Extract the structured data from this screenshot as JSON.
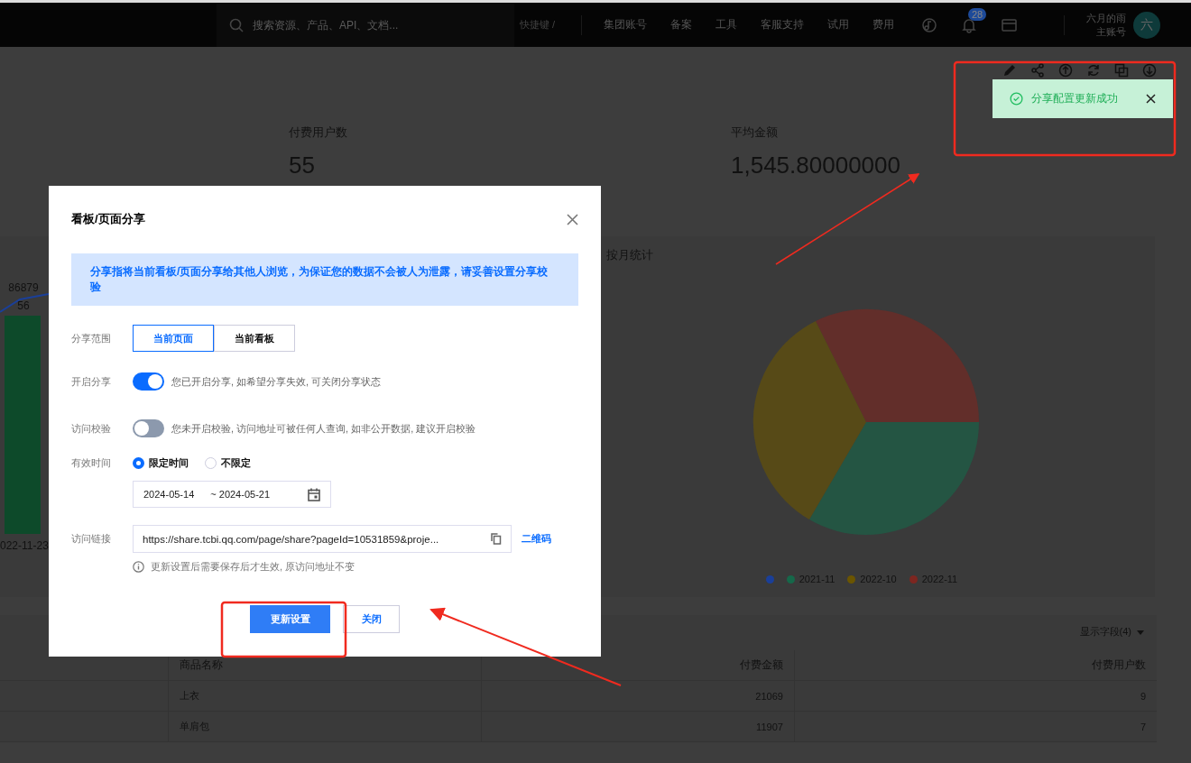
{
  "top_bar": {
    "search": {
      "placeholder": "搜索资源、产品、API、文档..."
    },
    "shortcut": "快捷键 /",
    "nav": [
      "集团账号",
      "备案",
      "工具",
      "客服支持",
      "试用",
      "费用"
    ],
    "notifications": "28",
    "user": {
      "name": "六月的雨",
      "role": "主账号",
      "avatar": "六"
    }
  },
  "toast": {
    "message": "分享配置更新成功"
  },
  "kpis": [
    {
      "label": "付费用户数",
      "value": "55"
    },
    {
      "label": "平均金额",
      "value": "1,545.80000000"
    }
  ],
  "left_chart": {
    "labels": [
      "86879",
      "56"
    ],
    "date": "022-11-23"
  },
  "pie_chart": {
    "title": "按月统计",
    "legend": [
      {
        "color": "#1a3f99"
      },
      {
        "label": "2021-11",
        "color": "#16684a"
      },
      {
        "label": "2022-10",
        "color": "#6b5500"
      },
      {
        "label": "2022-11",
        "color": "#7d2620"
      }
    ]
  },
  "table": {
    "fields_button": "显示字段(4)",
    "columns": [
      "商品名称",
      "付费金额",
      "付费用户数"
    ],
    "rows": [
      [
        "上衣",
        "21069",
        "9"
      ],
      [
        "单肩包",
        "11907",
        "7"
      ]
    ]
  },
  "dialog": {
    "title": "看板/页面分享",
    "notice": "分享指将当前看板/页面分享给其他人浏览，为保证您的数据不会被人为泄露，请妥善设置分享校验",
    "scope": {
      "label": "分享范围",
      "options": [
        {
          "label": "当前页面",
          "selected": true
        },
        {
          "label": "当前看板",
          "selected": false
        }
      ]
    },
    "toggles": [
      {
        "label": "开启分享",
        "on": true,
        "hint": "您已开启分享, 如希望分享失效, 可关闭分享状态"
      },
      {
        "label": "访问校验",
        "on": false,
        "hint": "您未开启校验, 访问地址可被任何人查询, 如非公开数据, 建议开启校验"
      }
    ],
    "validity": {
      "label": "有效时间",
      "options": [
        {
          "label": "限定时间",
          "selected": true
        },
        {
          "label": "不限定",
          "selected": false
        }
      ],
      "start": "2024-05-14",
      "separator": "~",
      "end": "2024-05-21"
    },
    "link": {
      "label": "访问链接",
      "value": "https://share.tcbi.qq.com/page/share?pageId=10531859&proje...",
      "qr": "二维码",
      "note": "更新设置后需要保存后才生效, 原访问地址不变"
    },
    "buttons": [
      {
        "kind": "primary",
        "label": "更新设置"
      },
      {
        "kind": "secondary",
        "label": "关闭"
      }
    ]
  }
}
